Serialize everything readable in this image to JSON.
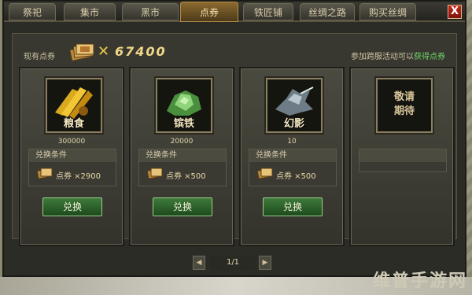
{
  "tabs": [
    {
      "label": "祭祀",
      "active": false
    },
    {
      "label": "集市",
      "active": false
    },
    {
      "label": "黑市",
      "active": false
    },
    {
      "label": "点券",
      "active": true
    },
    {
      "label": "铁匠铺",
      "active": false
    },
    {
      "label": "丝绸之路",
      "active": false
    },
    {
      "label": "购买丝绸",
      "active": false
    }
  ],
  "close_label": "X",
  "coupons": {
    "label": "现有点券",
    "multiplier": "✕",
    "count": "67400"
  },
  "event": {
    "text": "参加跨服活动可以",
    "link": "获得点券"
  },
  "items": [
    {
      "name": "粮食",
      "qty": "300000",
      "cond_title": "兑换条件",
      "cost": "点券 ×2900",
      "button": "兑换",
      "icon": "grain-icon"
    },
    {
      "name": "镔铁",
      "qty": "20000",
      "cond_title": "兑换条件",
      "cost": "点券 ×500",
      "button": "兑换",
      "icon": "iron-ore-icon"
    },
    {
      "name": "幻影",
      "qty": "10",
      "cond_title": "兑换条件",
      "cost": "点券 ×500",
      "button": "兑换",
      "icon": "phantom-horse-icon"
    }
  ],
  "coming_soon": {
    "line1": "敬请",
    "line2": "期待"
  },
  "pager": {
    "text": "1/1",
    "prev": "◀",
    "next": "▶"
  },
  "watermark": "维普手游网",
  "colors": {
    "accent": "#f1d78a",
    "link": "#6fd66b",
    "button": "#3d7a3a"
  }
}
